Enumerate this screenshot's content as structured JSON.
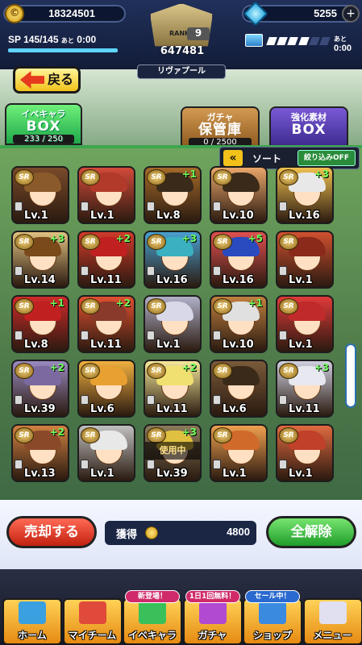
{
  "header": {
    "coins": "18324501",
    "gems": "5255",
    "gem_plus": "+",
    "sp_label": "SP 145/145",
    "sp_after": "あと",
    "sp_time": "0:00",
    "sp_fill": 1.0,
    "rank_label": "RANK",
    "rank_level": "9",
    "rank_score": "647481",
    "team_name": "リヴァプール",
    "stamina_after": "あと",
    "stamina_time": "0:00",
    "stamina_filled": 4,
    "stamina_total": 6
  },
  "nav_back": {
    "label": "戻る"
  },
  "tabs": {
    "event_chara": {
      "line1": "イベキャラ",
      "line2": "BOX",
      "count": "233 / 250"
    },
    "gacha": {
      "line1": "ガチャ",
      "line2": "保管庫",
      "count": "0 / 2500"
    },
    "material": {
      "line1": "強化素材",
      "line2": "BOX"
    }
  },
  "sort": {
    "arrow": "«",
    "label": "ソート",
    "filter": "絞り込みOFF"
  },
  "cards": [
    {
      "rank": "SR",
      "plus": "",
      "level": "Lv.1",
      "hair": "#8a5a2a",
      "bg": "#7a4a2a",
      "locked": true
    },
    {
      "rank": "SR",
      "plus": "",
      "level": "Lv.1",
      "hair": "#b23a2a",
      "bg": "#d24a3a",
      "locked": true
    },
    {
      "rank": "SR",
      "plus": "+1",
      "level": "Lv.8",
      "hair": "#3a2a1a",
      "bg": "#a46a2a",
      "locked": true
    },
    {
      "rank": "SR",
      "plus": "",
      "level": "Lv.10",
      "hair": "#3a2a1a",
      "bg": "#e9a66a",
      "locked": true
    },
    {
      "rank": "SR",
      "plus": "+3",
      "level": "Lv.16",
      "hair": "#e8e8e8",
      "bg": "#f0c050",
      "locked": true
    },
    {
      "rank": "SR",
      "plus": "+3",
      "level": "Lv.14",
      "hair": "#7a4a1a",
      "bg": "#e0c080",
      "locked": true
    },
    {
      "rank": "SR",
      "plus": "+2",
      "level": "Lv.11",
      "hair": "#c02020",
      "bg": "#d03a2a",
      "locked": true
    },
    {
      "rank": "SR",
      "plus": "+3",
      "level": "Lv.16",
      "hair": "#3ab0c0",
      "bg": "#4aa0d0",
      "locked": true
    },
    {
      "rank": "SR",
      "plus": "+5",
      "level": "Lv.16",
      "hair": "#2a4ac0",
      "bg": "#e05050",
      "locked": true
    },
    {
      "rank": "SR",
      "plus": "",
      "level": "Lv.1",
      "hair": "#8a2a1a",
      "bg": "#d05030",
      "locked": true
    },
    {
      "rank": "SR",
      "plus": "+1",
      "level": "Lv.8",
      "hair": "#c02020",
      "bg": "#d02a2a",
      "locked": true
    },
    {
      "rank": "SR",
      "plus": "+2",
      "level": "Lv.11",
      "hair": "#8a3a2a",
      "bg": "#e05030",
      "locked": true
    },
    {
      "rank": "SR",
      "plus": "",
      "level": "Lv.1",
      "hair": "#d8d8e8",
      "bg": "#b0b0c8",
      "locked": true
    },
    {
      "rank": "SR",
      "plus": "+1",
      "level": "Lv.10",
      "hair": "#e0e0e0",
      "bg": "#c08040",
      "locked": true
    },
    {
      "rank": "SR",
      "plus": "",
      "level": "Lv.1",
      "hair": "#c02a2a",
      "bg": "#e03a3a",
      "locked": true
    },
    {
      "rank": "SR",
      "plus": "+2",
      "level": "Lv.39",
      "hair": "#7a6aa0",
      "bg": "#9a8ac0",
      "locked": true
    },
    {
      "rank": "SR",
      "plus": "",
      "level": "Lv.6",
      "hair": "#e8a030",
      "bg": "#f0b040",
      "locked": true
    },
    {
      "rank": "SR",
      "plus": "+2",
      "level": "Lv.11",
      "hair": "#f0e070",
      "bg": "#f5e89a",
      "locked": true
    },
    {
      "rank": "SR",
      "plus": "",
      "level": "Lv.6",
      "hair": "#3a2a1a",
      "bg": "#7a5a3a",
      "locked": true
    },
    {
      "rank": "SR",
      "plus": "+3",
      "level": "Lv.11",
      "hair": "#e8e8f0",
      "bg": "#d0d0e0",
      "locked": true
    },
    {
      "rank": "SR",
      "plus": "+2",
      "level": "Lv.13",
      "hair": "#8a4a2a",
      "bg": "#d08040",
      "locked": true
    },
    {
      "rank": "SR",
      "plus": "",
      "level": "Lv.1",
      "hair": "#e8e8e8",
      "bg": "#c0c0c0",
      "locked": true
    },
    {
      "rank": "SR",
      "plus": "+3",
      "level": "Lv.39",
      "hair": "#e0c040",
      "bg": "#8a7a5a",
      "locked": true,
      "in_use": "使用中"
    },
    {
      "rank": "SR",
      "plus": "",
      "level": "Lv.1",
      "hair": "#d06a2a",
      "bg": "#f0a050",
      "locked": true
    },
    {
      "rank": "SR",
      "plus": "",
      "level": "Lv.1",
      "hair": "#c0402a",
      "bg": "#e06a40",
      "locked": true
    }
  ],
  "actions": {
    "sell": "売却する",
    "gain_label": "獲得",
    "gain_value": "4800",
    "clear_all": "全解除"
  },
  "nav": [
    {
      "label": "ホーム",
      "icon": "home-icon",
      "color": "#3aa0e0"
    },
    {
      "label": "マイチーム",
      "icon": "team-icon",
      "color": "#e04a3a"
    },
    {
      "label": "イベキャラ",
      "icon": "event-chara-icon",
      "color": "#3ac05a",
      "badge": "新登場！",
      "badge_color": "#d02a6a"
    },
    {
      "label": "ガチャ",
      "icon": "gacha-icon",
      "color": "#b04ad0",
      "badge": "1日1回無料！",
      "badge_color": "#d02a6a"
    },
    {
      "label": "ショップ",
      "icon": "shop-icon",
      "color": "#3a8ae0",
      "badge": "セール中！",
      "badge_color": "#2a6ad0"
    },
    {
      "label": "メニュー",
      "icon": "menu-icon",
      "color": "#e0e0f0"
    }
  ]
}
